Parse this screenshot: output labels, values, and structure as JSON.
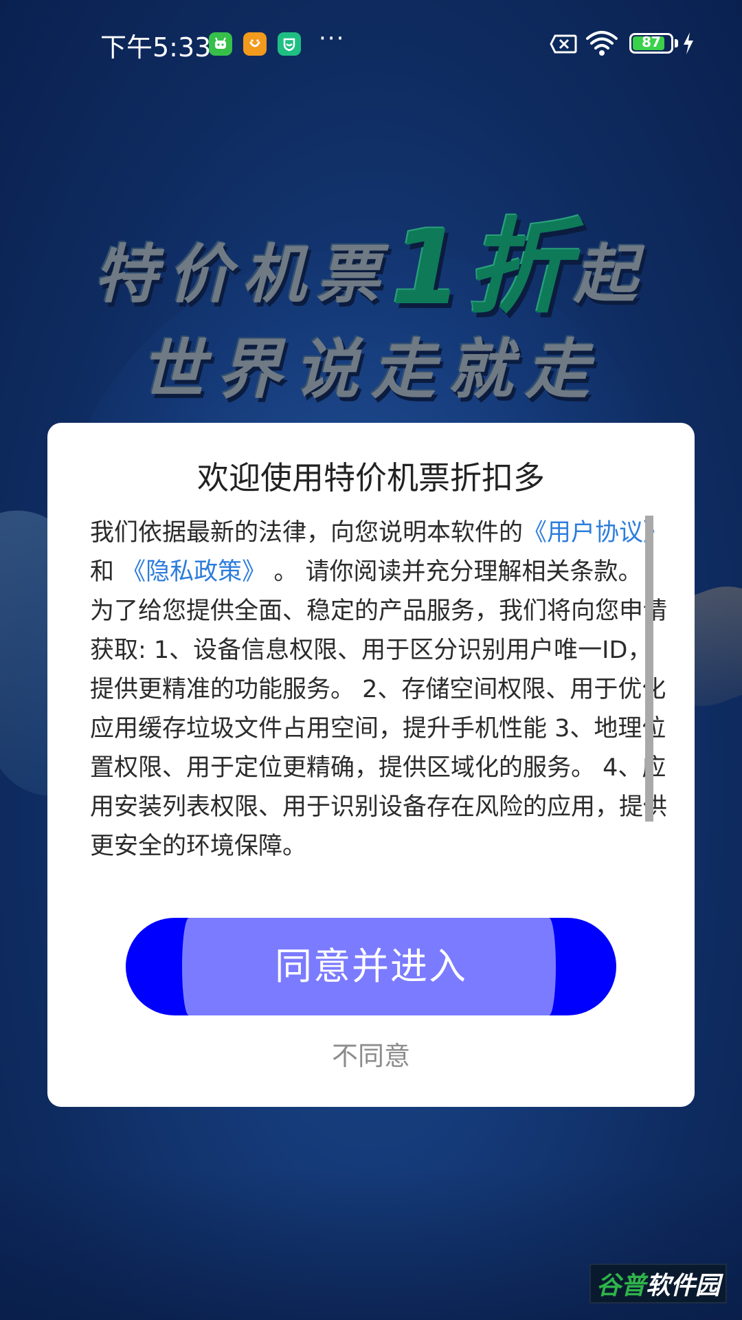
{
  "status_bar": {
    "time": "下午5:33",
    "more": "···",
    "battery_level": "87",
    "battery_fraction": 0.87
  },
  "promo": {
    "line1_prefix": "特价机票",
    "line1_highlight": "1折",
    "line1_suffix": "起",
    "line2": "世界说走就走"
  },
  "dialog": {
    "title": "欢迎使用特价机票折扣多",
    "terms": {
      "intro": "我们依据最新的法律，向您说明本软件的",
      "link_user_agreement": "《用户协议》",
      "and": "和",
      "link_privacy_policy": "《隐私政策》",
      "intro_end": "。 请你阅读并充分理解相关条款。",
      "body": "为了给您提供全面、稳定的产品服务，我们将向您申请获取: 1、设备信息权限、用于区分识别用户唯一ID，提供更精准的功能服务。 2、存储空间权限、用于优化应用缓存垃圾文件占用空间，提升手机性能 3、地理位置权限、用于定位更精确，提供区域化的服务。 4、应用安装列表权限、用于识别设备存在风险的应用，提供更安全的环境保障。"
    },
    "agree_button": "同意并进入",
    "disagree_link": "不同意"
  },
  "watermark": {
    "part_a": "谷普",
    "part_b": "软件园"
  },
  "colors": {
    "accent_blue": "#0000ff",
    "button_inner": "#7b7bff",
    "link": "#2d7ddc",
    "promo_green": "#0e7a58"
  }
}
